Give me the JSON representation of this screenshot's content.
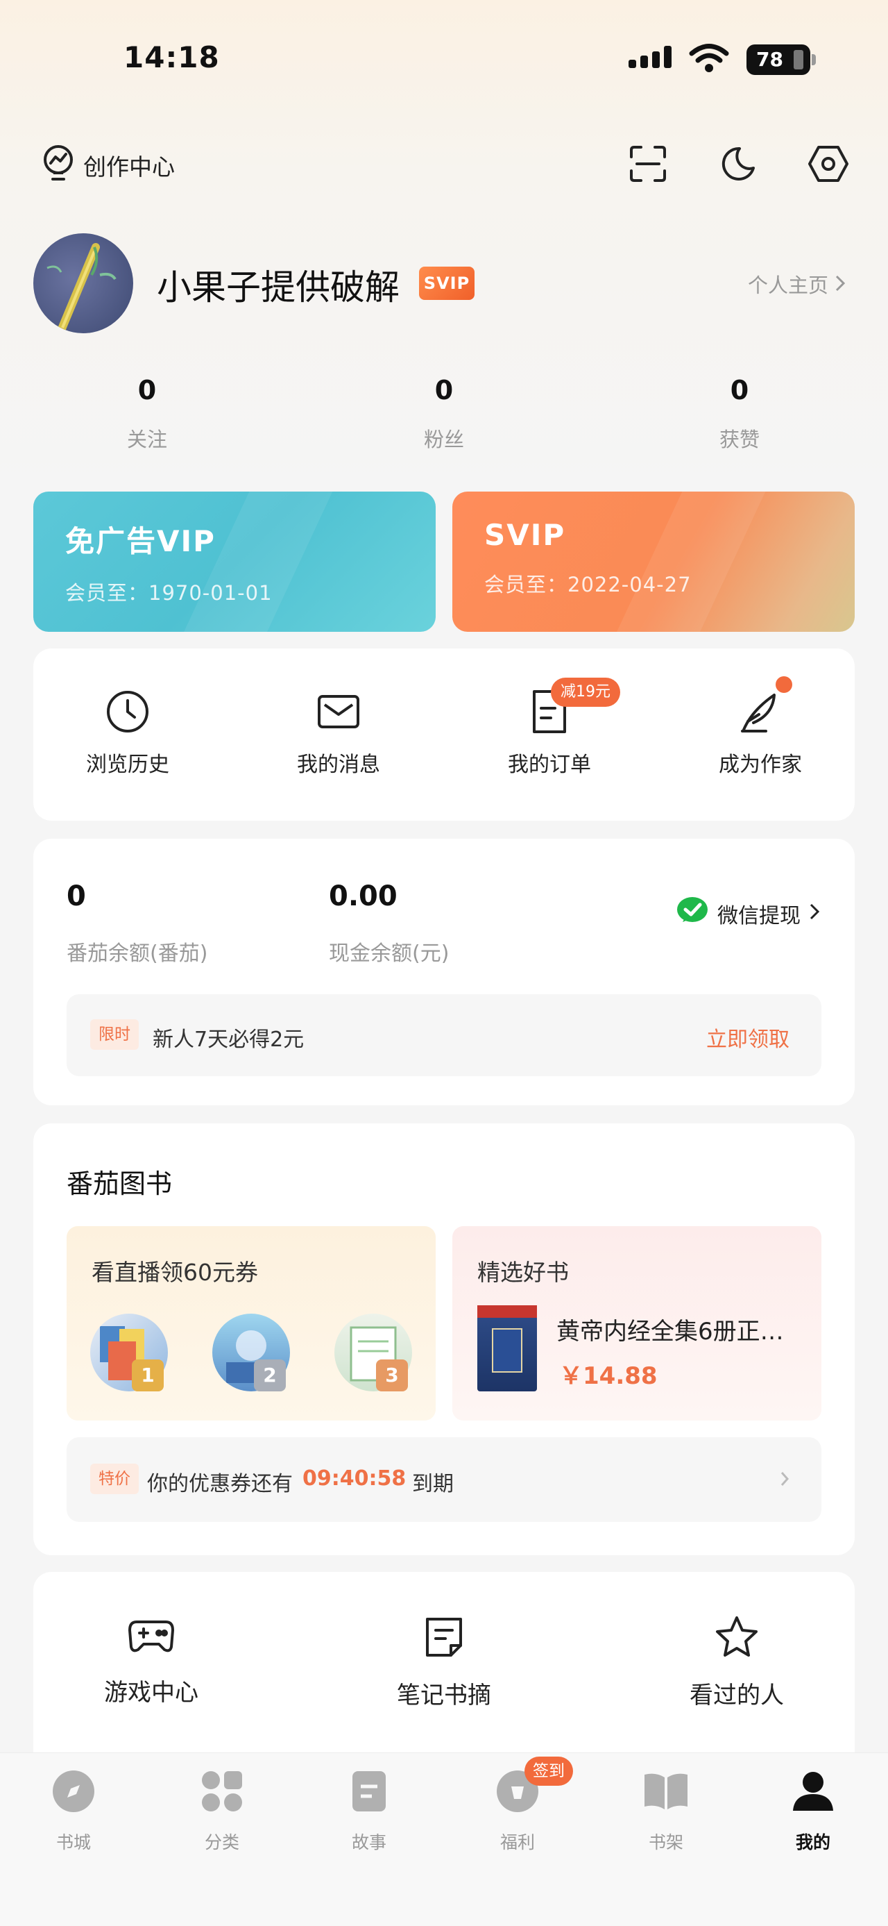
{
  "status_bar": {
    "time": "14:18",
    "battery": "78"
  },
  "header": {
    "creator_center": "创作中心"
  },
  "profile": {
    "username": "小果子提供破解",
    "badge": "SVIP",
    "homepage_link": "个人主页"
  },
  "stats": [
    {
      "value": "0",
      "label": "关注"
    },
    {
      "value": "0",
      "label": "粉丝"
    },
    {
      "value": "0",
      "label": "获赞"
    }
  ],
  "vip_cards": {
    "ad_free": {
      "title": "免广告VIP",
      "expiry": "会员至：1970-01-01"
    },
    "svip": {
      "title": "SVIP",
      "expiry": "会员至：2022-04-27"
    }
  },
  "quick_actions": [
    {
      "label": "浏览历史",
      "icon": "clock-icon"
    },
    {
      "label": "我的消息",
      "icon": "envelope-icon"
    },
    {
      "label": "我的订单",
      "icon": "order-icon",
      "badge": "减19元"
    },
    {
      "label": "成为作家",
      "icon": "quill-icon"
    }
  ],
  "balance": {
    "tomato_value": "0",
    "tomato_label": "番茄余额(番茄)",
    "cash_value": "0.00",
    "cash_label": "现金余额(元)",
    "withdraw": "微信提现",
    "promo_tag": "限时",
    "promo_text": "新人7天必得2元",
    "promo_action": "立即领取"
  },
  "books": {
    "section_title": "番茄图书",
    "live_title": "看直播领60元券",
    "ranks": [
      "1",
      "2",
      "3"
    ],
    "pick_title": "精选好书",
    "pick_book": "黄帝内经全集6册正…",
    "pick_price": "￥14.88",
    "coupon_tag": "特价",
    "coupon_prefix": "你的优惠券还有",
    "coupon_time": "09:40:58",
    "coupon_suffix": "到期"
  },
  "tools": [
    {
      "label": "游戏中心",
      "icon": "gamepad-icon"
    },
    {
      "label": "笔记书摘",
      "icon": "note-icon"
    },
    {
      "label": "看过的人",
      "icon": "star-icon"
    }
  ],
  "tabbar": {
    "items": [
      "书城",
      "分类",
      "故事",
      "福利",
      "书架",
      "我的"
    ],
    "active": "我的",
    "sign_badge": "签到"
  },
  "colors": {
    "accent": "#f26a3c",
    "vip_blue": "#4fc1d2",
    "vip_orange": "#f98b55"
  }
}
